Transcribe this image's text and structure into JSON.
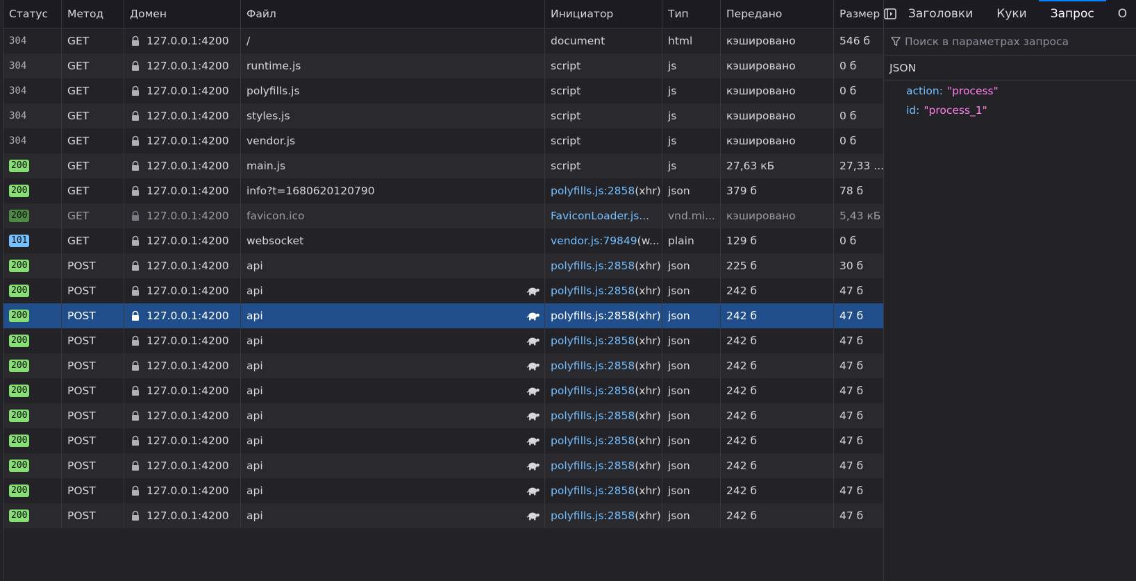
{
  "columns": {
    "status": "Статус",
    "method": "Метод",
    "domain": "Домен",
    "file": "Файл",
    "initiator": "Инициатор",
    "type": "Тип",
    "transferred": "Передано",
    "size": "Размер"
  },
  "requests": [
    {
      "status": "304",
      "method": "GET",
      "domain": "127.0.0.1:4200",
      "file": "/",
      "initiator_link": "",
      "initiator_text": "document",
      "type": "html",
      "transferred": "кэшировано",
      "size": "546 б"
    },
    {
      "status": "304",
      "method": "GET",
      "domain": "127.0.0.1:4200",
      "file": "runtime.js",
      "initiator_link": "",
      "initiator_text": "script",
      "type": "js",
      "transferred": "кэшировано",
      "size": "0 б"
    },
    {
      "status": "304",
      "method": "GET",
      "domain": "127.0.0.1:4200",
      "file": "polyfills.js",
      "initiator_link": "",
      "initiator_text": "script",
      "type": "js",
      "transferred": "кэшировано",
      "size": "0 б"
    },
    {
      "status": "304",
      "method": "GET",
      "domain": "127.0.0.1:4200",
      "file": "styles.js",
      "initiator_link": "",
      "initiator_text": "script",
      "type": "js",
      "transferred": "кэшировано",
      "size": "0 б"
    },
    {
      "status": "304",
      "method": "GET",
      "domain": "127.0.0.1:4200",
      "file": "vendor.js",
      "initiator_link": "",
      "initiator_text": "script",
      "type": "js",
      "transferred": "кэшировано",
      "size": "0 б"
    },
    {
      "status": "200",
      "method": "GET",
      "domain": "127.0.0.1:4200",
      "file": "main.js",
      "initiator_link": "",
      "initiator_text": "script",
      "type": "js",
      "transferred": "27,63 кБ",
      "size": "27,33 ..."
    },
    {
      "status": "200",
      "method": "GET",
      "domain": "127.0.0.1:4200",
      "file": "info?t=1680620120790",
      "initiator_link": "polyfills.js:2858",
      "initiator_text": " (xhr)",
      "type": "json",
      "transferred": "379 б",
      "size": "78 б"
    },
    {
      "status": "200",
      "method": "GET",
      "domain": "127.0.0.1:4200",
      "file": "favicon.ico",
      "initiator_link": "FaviconLoader.js...",
      "initiator_text": "",
      "type": "vnd.mi...",
      "transferred": "кэшировано",
      "size": "5,43 кБ"
    },
    {
      "status": "101",
      "method": "GET",
      "domain": "127.0.0.1:4200",
      "file": "websocket",
      "initiator_link": "vendor.js:79849",
      "initiator_text": " (w...",
      "type": "plain",
      "transferred": "129 б",
      "size": "0 б"
    },
    {
      "status": "200",
      "method": "POST",
      "domain": "127.0.0.1:4200",
      "file": "api",
      "initiator_link": "polyfills.js:2858",
      "initiator_text": " (xhr)",
      "type": "json",
      "transferred": "225 б",
      "size": "30 б"
    },
    {
      "status": "200",
      "method": "POST",
      "domain": "127.0.0.1:4200",
      "file": "api",
      "initiator_link": "polyfills.js:2858",
      "initiator_text": " (xhr)",
      "type": "json",
      "transferred": "242 б",
      "size": "47 б"
    },
    {
      "status": "200",
      "method": "POST",
      "domain": "127.0.0.1:4200",
      "file": "api",
      "initiator_link": "polyfills.js:2858",
      "initiator_text": " (xhr)",
      "type": "json",
      "transferred": "242 б",
      "size": "47 б"
    },
    {
      "status": "200",
      "method": "POST",
      "domain": "127.0.0.1:4200",
      "file": "api",
      "initiator_link": "polyfills.js:2858",
      "initiator_text": " (xhr)",
      "type": "json",
      "transferred": "242 б",
      "size": "47 б"
    },
    {
      "status": "200",
      "method": "POST",
      "domain": "127.0.0.1:4200",
      "file": "api",
      "initiator_link": "polyfills.js:2858",
      "initiator_text": " (xhr)",
      "type": "json",
      "transferred": "242 б",
      "size": "47 б"
    },
    {
      "status": "200",
      "method": "POST",
      "domain": "127.0.0.1:4200",
      "file": "api",
      "initiator_link": "polyfills.js:2858",
      "initiator_text": " (xhr)",
      "type": "json",
      "transferred": "242 б",
      "size": "47 б"
    },
    {
      "status": "200",
      "method": "POST",
      "domain": "127.0.0.1:4200",
      "file": "api",
      "initiator_link": "polyfills.js:2858",
      "initiator_text": " (xhr)",
      "type": "json",
      "transferred": "242 б",
      "size": "47 б"
    },
    {
      "status": "200",
      "method": "POST",
      "domain": "127.0.0.1:4200",
      "file": "api",
      "initiator_link": "polyfills.js:2858",
      "initiator_text": " (xhr)",
      "type": "json",
      "transferred": "242 б",
      "size": "47 б"
    },
    {
      "status": "200",
      "method": "POST",
      "domain": "127.0.0.1:4200",
      "file": "api",
      "initiator_link": "polyfills.js:2858",
      "initiator_text": " (xhr)",
      "type": "json",
      "transferred": "242 б",
      "size": "47 б"
    },
    {
      "status": "200",
      "method": "POST",
      "domain": "127.0.0.1:4200",
      "file": "api",
      "initiator_link": "polyfills.js:2858",
      "initiator_text": " (xhr)",
      "type": "json",
      "transferred": "242 б",
      "size": "47 б"
    },
    {
      "status": "200",
      "method": "POST",
      "domain": "127.0.0.1:4200",
      "file": "api",
      "initiator_link": "polyfills.js:2858",
      "initiator_text": " (xhr)",
      "type": "json",
      "transferred": "242 б",
      "size": "47 б"
    }
  ],
  "row_flags": [
    {
      "badge": "text",
      "dim": false,
      "turtle": false
    },
    {
      "badge": "text",
      "dim": false,
      "turtle": false
    },
    {
      "badge": "text",
      "dim": false,
      "turtle": false
    },
    {
      "badge": "text",
      "dim": false,
      "turtle": false
    },
    {
      "badge": "text",
      "dim": false,
      "turtle": false
    },
    {
      "badge": "ok",
      "dim": false,
      "turtle": false
    },
    {
      "badge": "ok",
      "dim": false,
      "turtle": false
    },
    {
      "badge": "cached",
      "dim": true,
      "turtle": false
    },
    {
      "badge": "info",
      "dim": false,
      "turtle": false
    },
    {
      "badge": "ok",
      "dim": false,
      "turtle": false
    },
    {
      "badge": "ok",
      "dim": false,
      "turtle": true
    },
    {
      "badge": "ok",
      "dim": false,
      "turtle": true
    },
    {
      "badge": "ok",
      "dim": false,
      "turtle": true
    },
    {
      "badge": "ok",
      "dim": false,
      "turtle": true
    },
    {
      "badge": "ok",
      "dim": false,
      "turtle": true
    },
    {
      "badge": "ok",
      "dim": false,
      "turtle": true
    },
    {
      "badge": "ok",
      "dim": false,
      "turtle": true
    },
    {
      "badge": "ok",
      "dim": false,
      "turtle": true
    },
    {
      "badge": "ok",
      "dim": false,
      "turtle": true
    },
    {
      "badge": "ok",
      "dim": false,
      "turtle": true
    }
  ],
  "selected_row": 11,
  "side_panel": {
    "tabs": [
      "Заголовки",
      "Куки",
      "Запрос",
      "О"
    ],
    "active_tab": 2,
    "filter_placeholder": "Поиск в параметрах запроса",
    "json_label": "JSON",
    "json_fields": [
      {
        "key": "action:",
        "value": "\"process\""
      },
      {
        "key": "id:",
        "value": "\"process_1\""
      }
    ]
  },
  "colors": {
    "accent": "#0a84ff",
    "selected_row": "#204e8a",
    "link": "#75bfff",
    "status_ok": "#86de74",
    "status_info": "#75bfff",
    "json_string": "#ff7de9"
  }
}
